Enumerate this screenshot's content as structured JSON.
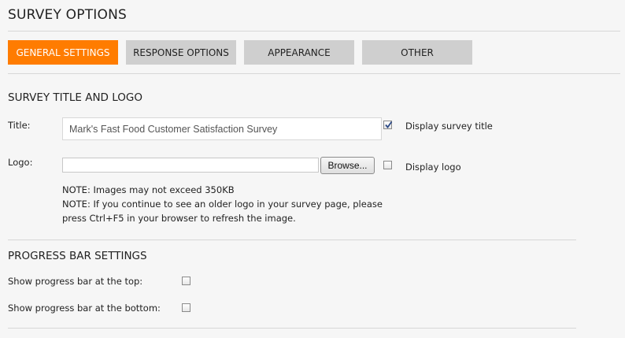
{
  "page": {
    "title": "SURVEY OPTIONS"
  },
  "tabs": [
    {
      "label": "GENERAL SETTINGS",
      "active": true
    },
    {
      "label": "RESPONSE OPTIONS",
      "active": false
    },
    {
      "label": "APPEARANCE",
      "active": false
    },
    {
      "label": "OTHER",
      "active": false
    }
  ],
  "colors": {
    "active_tab": "#ff7c00",
    "inactive_tab": "#cfcfcf"
  },
  "title_logo": {
    "heading": "SURVEY TITLE AND LOGO",
    "title_label": "Title:",
    "title_value": "Mark's Fast Food Customer Satisfaction Survey",
    "display_title_label": "Display survey title",
    "display_title_checked": true,
    "logo_label": "Logo:",
    "logo_value": "",
    "browse_label": "Browse...",
    "display_logo_label": "Display logo",
    "display_logo_checked": false,
    "note1": "NOTE: Images may not exceed 350KB",
    "note2_line1": "NOTE: If you continue to see an older logo in your survey page, please",
    "note2_line2": "press Ctrl+F5 in your browser to refresh the image."
  },
  "progress": {
    "heading": "PROGRESS BAR SETTINGS",
    "top_label": "Show progress bar at the top:",
    "top_checked": false,
    "bottom_label": "Show progress bar at the bottom:",
    "bottom_checked": false
  }
}
